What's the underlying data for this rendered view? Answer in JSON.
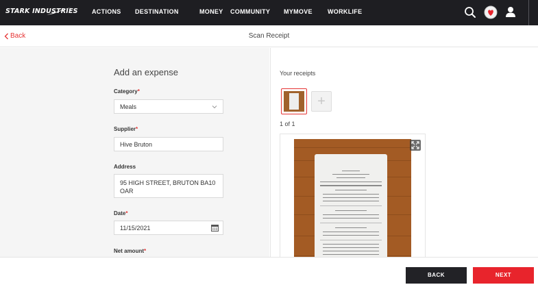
{
  "brand": {
    "logo_text": "STARK INDUSTRIES"
  },
  "nav": {
    "items": [
      {
        "label": "ACTIONS"
      },
      {
        "label": "DESTINATION"
      },
      {
        "label": "MONEY"
      },
      {
        "label": "COMMUNITY"
      },
      {
        "label": "MYMOVE"
      },
      {
        "label": "WORKLIFE"
      }
    ],
    "icons": [
      "search-icon",
      "avatar-heart-icon",
      "user-icon"
    ]
  },
  "subheader": {
    "back_label": "Back",
    "title": "Scan Receipt"
  },
  "form": {
    "title": "Add an expense",
    "category": {
      "label": "Category",
      "value": "Meals"
    },
    "supplier": {
      "label": "Supplier",
      "value": "Hive Bruton"
    },
    "address": {
      "label": "Address",
      "value": "95 HIGH STREET, BRUTON BA10 OAR"
    },
    "date": {
      "label": "Date",
      "value": "11/15/2021"
    },
    "net_amount": {
      "label": "Net amount"
    },
    "required_marker": "*"
  },
  "receipts": {
    "title": "Your receipts",
    "count": "1 of 1",
    "add_symbol": "+"
  },
  "footer": {
    "back_label": "BACK",
    "next_label": "NEXT"
  },
  "colors": {
    "accent": "#e8242c",
    "nav_bg": "#1e1e22",
    "panel_bg": "#f5f5f5"
  }
}
